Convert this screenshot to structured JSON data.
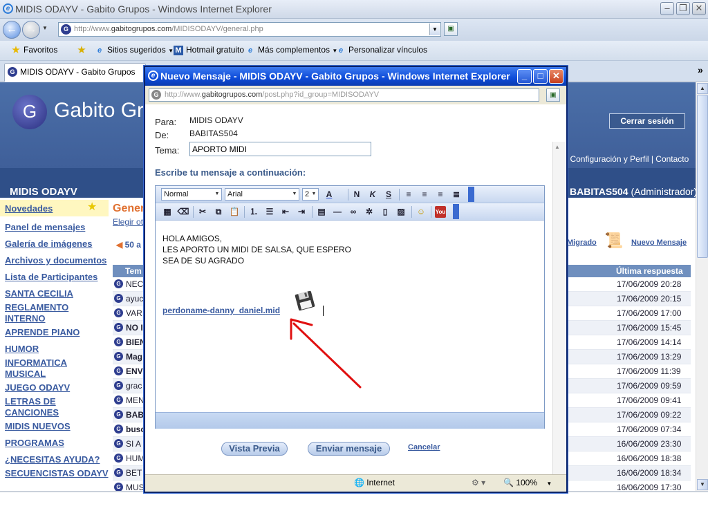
{
  "browser": {
    "window_title": "MIDIS ODAYV - Gabito Grupos - Windows Internet Explorer",
    "url_prefix": "http://www.",
    "url_host": "gabitogrupos.com",
    "url_path": "/MIDISODAYV/general.php",
    "tab_label": "MIDIS ODAYV - Gabito Grupos",
    "favorites_label": "Favoritos",
    "fav_links": [
      "Sitios sugeridos",
      "Hotmail gratuito",
      "Más complementos",
      "Personalizar vínculos"
    ],
    "chevron": "»"
  },
  "page": {
    "brand": "Gabito Gru",
    "logo_letter": "G",
    "logout": "Cerrar sesión",
    "top_links": "| Configuración y Perfil  |  Contacto",
    "group_name": "MIDIS ODAYV",
    "user_name": "BABITAS504",
    "user_role": "(Administrador)",
    "content_title": "Gener",
    "elegir": "Elegir ot",
    "pager": "50 a",
    "migrado": "Migrado",
    "nuevo_mensaje": "Nuevo Mensaje",
    "col_topic": "Tem",
    "col_last": "Última respuesta",
    "sidebar": [
      "Novedades",
      "Panel de mensajes",
      "Galería de imágenes",
      "Archivos y documentos",
      "Lista de Participantes",
      "SANTA CECILIA",
      "REGLAMENTO INTERNO",
      "APRENDE PIANO",
      "HUMOR",
      "INFORMATICA MUSICAL",
      "JUEGO ODAYV",
      "LETRAS DE CANCIONES",
      "MIDIS NUEVOS",
      "PROGRAMAS",
      "¿NECESITAS AYUDA?",
      "SECUENCISTAS ODAYV"
    ],
    "rows": [
      {
        "topic": "NEC",
        "date": "17/06/2009 20:28"
      },
      {
        "topic": "ayuc",
        "date": "17/06/2009 20:15"
      },
      {
        "topic": "VAR",
        "date": "17/06/2009 17:00"
      },
      {
        "topic": "NO I",
        "date": "17/06/2009 15:45"
      },
      {
        "topic": "BIEN",
        "date": "17/06/2009 14:14"
      },
      {
        "topic": "Mag",
        "date": "17/06/2009 13:29"
      },
      {
        "topic": "ENV",
        "date": "17/06/2009 11:39"
      },
      {
        "topic": "grac",
        "date": "17/06/2009 09:59"
      },
      {
        "topic": "MEN",
        "date": "17/06/2009 09:41"
      },
      {
        "topic": "BAB",
        "date": "17/06/2009 09:22"
      },
      {
        "topic": "busc",
        "date": "17/06/2009 07:34"
      },
      {
        "topic": "SI A",
        "date": "16/06/2009 23:30"
      },
      {
        "topic": "HUM",
        "date": "16/06/2009 18:38"
      },
      {
        "topic": "BET",
        "date": "16/06/2009 18:34"
      },
      {
        "topic": "MUS",
        "date": "16/06/2009 17:30"
      }
    ]
  },
  "popup": {
    "title": "Nuevo Mensaje - MIDIS ODAYV - Gabito Grupos - Windows Internet Explorer",
    "url_prefix": "http://www.",
    "url_host": "gabitogrupos.com",
    "url_path": "/post.php?id_group=MIDISODAYV",
    "para_label": "Para:",
    "para_value": "MIDIS ODAYV",
    "de_label": "De:",
    "de_value": "BABITAS504",
    "tema_label": "Tema:",
    "tema_value": "APORTO MIDI",
    "instructions": "Escribe tu mensaje a continuación:",
    "format_select": "Normal",
    "font_select": "Arial",
    "size_select": "2",
    "body_lines": [
      "HOLA AMIGOS,",
      "LES APORTO UN MIDI DE SALSA,  QUE ESPERO",
      "SEA DE SU  AGRADO"
    ],
    "attachment": "perdoname-danny_daniel.mid",
    "preview_btn": "Vista Previa",
    "send_btn": "Enviar mensaje",
    "cancel": "Cancelar",
    "status_zone": "Internet",
    "zoom": "100%"
  },
  "colors": {
    "accent": "#3a5ba0",
    "banner": "#4b6fa8",
    "popup_title": "#0c4ad8",
    "annotation_arrow": "#e01010"
  }
}
